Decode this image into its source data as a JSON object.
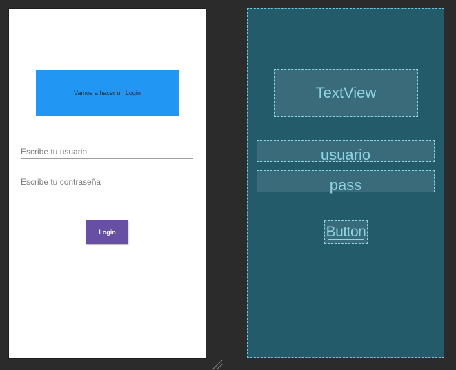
{
  "design": {
    "title_text": "Vamos a hacer un Login",
    "user_placeholder": "Escribe tu usuario",
    "pass_placeholder": "Escribe tu contraseña",
    "login_label": "Login"
  },
  "blueprint": {
    "textview_label": "TextView",
    "user_label": "usuario",
    "pass_label": "pass",
    "button_label": "Button"
  },
  "colors": {
    "title_bg": "#2196f3",
    "button_bg": "#6750a4",
    "blueprint_bg": "#235b6b",
    "workspace_bg": "#2b2b2b"
  }
}
